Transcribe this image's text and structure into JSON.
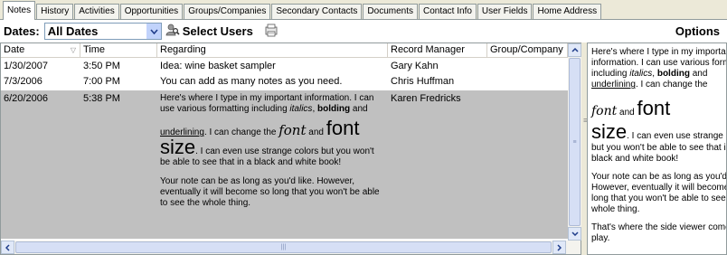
{
  "tabs": [
    {
      "label": "Notes",
      "active": true
    },
    {
      "label": "History"
    },
    {
      "label": "Activities"
    },
    {
      "label": "Opportunities"
    },
    {
      "label": "Groups/Companies"
    },
    {
      "label": "Secondary Contacts"
    },
    {
      "label": "Documents"
    },
    {
      "label": "Contact Info"
    },
    {
      "label": "User Fields"
    },
    {
      "label": "Home Address"
    }
  ],
  "toolbar": {
    "dates_label": "Dates:",
    "dates_value": "All Dates",
    "select_users_label": "Select Users",
    "options_label": "Options"
  },
  "grid": {
    "columns": [
      "Date",
      "Time",
      "Regarding",
      "Record Manager",
      "Group/Company"
    ],
    "rows": [
      {
        "date": "1/30/2007",
        "time": "3:50 PM",
        "regarding": "Idea: wine basket sampler",
        "manager": "Gary Kahn",
        "group": ""
      },
      {
        "date": "7/3/2006",
        "time": "7:00 PM",
        "regarding": "You can add as many notes as you need.",
        "manager": "Chris Huffman",
        "group": ""
      },
      {
        "date": "6/20/2006",
        "time": "5:38 PM",
        "regarding": "",
        "manager": "Karen Fredricks",
        "group": ""
      }
    ],
    "note": {
      "p1_a": "Here's where I type in my important information.  I can use various formatting including ",
      "p1_italics": "italics",
      "p1_b": ", ",
      "p1_bold": "bolding",
      "p1_c": " and",
      "p2_underline": "underlining",
      "p2_a": ".  I can change the ",
      "p2_font_script": "font",
      "p2_and": " and ",
      "p2_font_big": "font",
      "p3_size": "size",
      "p3_a": ".  I can even use strange colors but you won't be able to see that in a black and white book!",
      "p4": "Your note can be as long as you'd like.  However, eventually it will become so long that you won't be able to see the whole thing."
    }
  },
  "viewer": {
    "p1_a": "Here's where I type in my important information.  I can use various formatting including ",
    "p1_italics": "italics",
    "p1_b": ", ",
    "p1_bold": "bolding",
    "p1_c": " and ",
    "p1_underline": "underlining",
    "p1_d": ".  I can change the",
    "font_script": "font",
    "and": " and ",
    "font_big": "font",
    "size": "size",
    "p2_a": ".  I can even use strange colors but you won't be able to see that in a black and white book!",
    "p3": "Your note can be as long as you'd like.  However, eventually it will become so long that you won't be able to see the whole thing.",
    "p4": "That's where the side viewer comes into play."
  }
}
